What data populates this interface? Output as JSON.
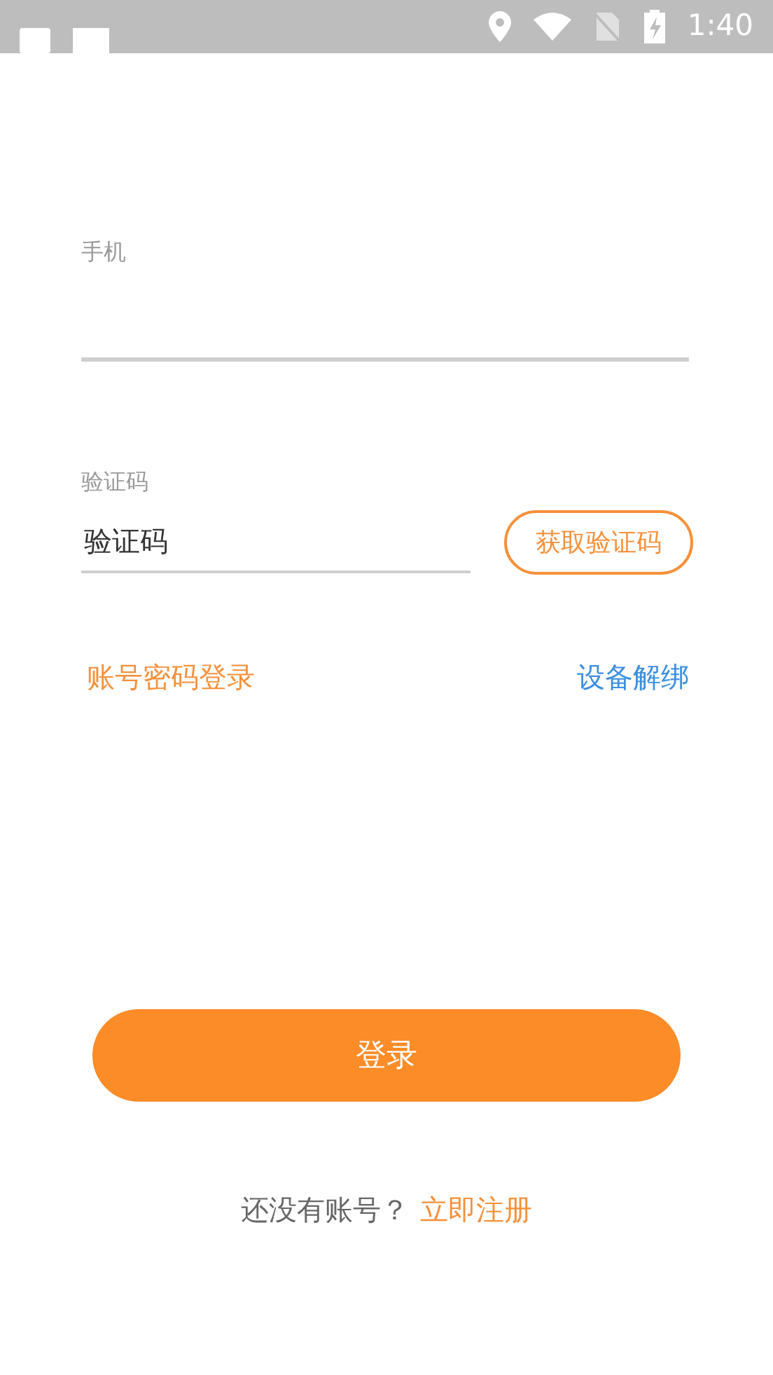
{
  "status_bar": {
    "time": "1:40"
  },
  "phone_field": {
    "label": "手机"
  },
  "code_field": {
    "label": "验证码",
    "value": "验证码"
  },
  "get_code_button": "获取验证码",
  "password_login_link": "账号密码登录",
  "unbind_device_link": "设备解绑",
  "login_button": "登录",
  "register_prompt": {
    "text": "还没有账号？",
    "link": "立即注册"
  }
}
